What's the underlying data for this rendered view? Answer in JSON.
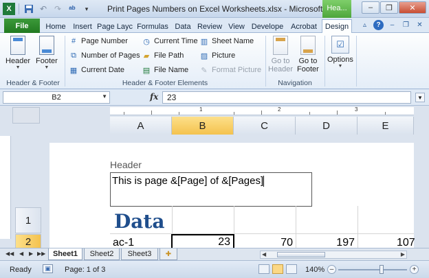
{
  "window": {
    "title": "Print Pages Numbers on Excel Worksheets.xlsx - Microsoft ...",
    "context_tab": "Hea...",
    "buttons": {
      "minimize": "–",
      "restore": "❐",
      "close": "✕"
    }
  },
  "qat": {
    "icons": [
      "excel-logo-icon",
      "save-icon",
      "undo-icon",
      "redo-icon",
      "spellcheck-icon",
      "customize-icon"
    ]
  },
  "tabs": {
    "file": "File",
    "items": [
      "Home",
      "Insert",
      "Page Layc",
      "Formulas",
      "Data",
      "Review",
      "View",
      "Develope",
      "Acrobat",
      "Design"
    ],
    "active": "Design"
  },
  "ribbon": {
    "groups": {
      "header_footer": {
        "label": "Header & Footer",
        "header": "Header",
        "footer": "Footer"
      },
      "elements": {
        "label": "Header & Footer Elements",
        "page_number": "Page Number",
        "number_of_pages": "Number of Pages",
        "current_date": "Current Date",
        "current_time": "Current Time",
        "file_path": "File Path",
        "file_name": "File Name",
        "sheet_name": "Sheet Name",
        "picture": "Picture",
        "format_picture": "Format Picture"
      },
      "navigation": {
        "label": "Navigation",
        "go_to_header_1": "Go to",
        "go_to_header_2": "Header",
        "go_to_footer_1": "Go to",
        "go_to_footer_2": "Footer"
      },
      "options": {
        "label": "Options"
      }
    }
  },
  "formula_bar": {
    "name_box": "B2",
    "fx": "fx",
    "value": "23"
  },
  "ruler": {
    "marks": [
      "1",
      "2",
      "3"
    ]
  },
  "sheet": {
    "columns": [
      "A",
      "B",
      "C",
      "D",
      "E"
    ],
    "selected_column": "B",
    "rows": [
      "1",
      "2"
    ],
    "selected_row": "2",
    "header_label": "Header",
    "header_text": "This is page &[Page] of &[Pages]",
    "cells": {
      "A1": "Data",
      "A2": "ac-1",
      "B2": "23",
      "C2": "70",
      "D2": "197",
      "E2": "107"
    }
  },
  "sheet_tabs": {
    "items": [
      "Sheet1",
      "Sheet2",
      "Sheet3"
    ],
    "active": "Sheet1"
  },
  "status": {
    "ready": "Ready",
    "page": "Page: 1 of 3",
    "zoom": "140%"
  }
}
